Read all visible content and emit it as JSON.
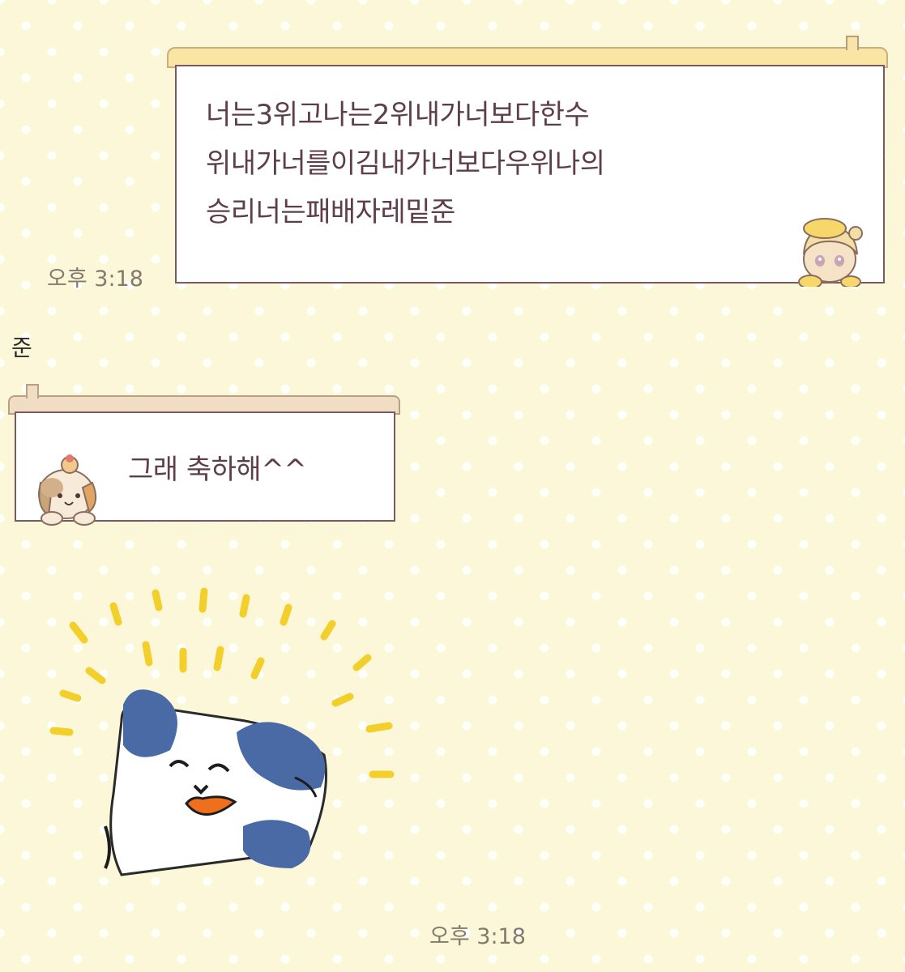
{
  "chat": {
    "messages": [
      {
        "direction": "outgoing",
        "lines": [
          "너는3위고나는2위내가너보다한수",
          "위내가너를이김내가너보다우위나의",
          "승리너는패배자레밑준"
        ],
        "timestamp": "오후 3:18"
      },
      {
        "direction": "incoming",
        "sender": "준",
        "text": "그래 축하해^^"
      },
      {
        "direction": "incoming",
        "type": "sticker",
        "sticker_icon": "happy-dog-sticker",
        "timestamp": "오후 3:18"
      }
    ]
  },
  "colors": {
    "background": "#fdf7d9",
    "dots": "#ffffff",
    "bubble_text": "#5e3e4a",
    "bubble_border": "#7a5a62",
    "timestamp": "#85796d"
  }
}
